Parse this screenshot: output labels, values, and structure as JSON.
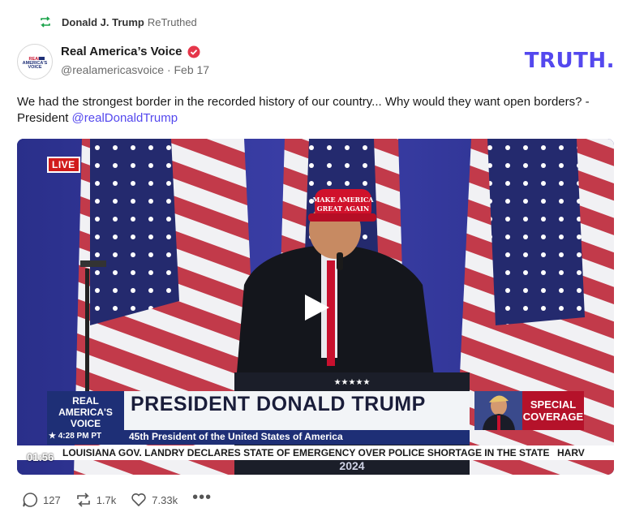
{
  "retruth": {
    "user": "Donald J. Trump",
    "action": "ReTruthed",
    "icon": "retruth-icon"
  },
  "author": {
    "name": "Real America’s Voice",
    "handle": "@realamericasvoice",
    "separator": "·",
    "date": "Feb 17",
    "verified_icon": "verified-badge-icon",
    "avatar_text": "REAL AMERICA'S VOICE"
  },
  "brand": {
    "logo_text": "TRUTH.",
    "color": "#5448ee"
  },
  "post": {
    "text": "We had the strongest border in the recorded history of our country... Why would they want open borders? - President ",
    "mention": "@realDonaldTrump"
  },
  "video": {
    "live_label": "LIVE",
    "duration": "01:56",
    "play_icon": "play-icon",
    "hat_text": "MAKE AMERICA GREAT AGAIN",
    "podium_text": "2024",
    "lower_third": {
      "network": "REAL AMERICA'S VOICE",
      "headline": "PRESIDENT DONALD TRUMP",
      "time": "4:28 PM PT",
      "subtitle": "45th President of the United States of America",
      "special": "SPECIAL COVERAGE"
    },
    "ticker": "LOUISIANA GOV. LANDRY DECLARES STATE OF EMERGENCY OVER POLICE SHORTAGE IN THE STATE",
    "ticker_end": "HARV"
  },
  "actions": {
    "replies": "127",
    "retruths": "1.7k",
    "likes": "7.33k",
    "reply_icon": "comment-icon",
    "retruth_icon": "retruth-icon",
    "like_icon": "heart-icon",
    "more_icon": "more-icon",
    "more_label": "•••"
  }
}
